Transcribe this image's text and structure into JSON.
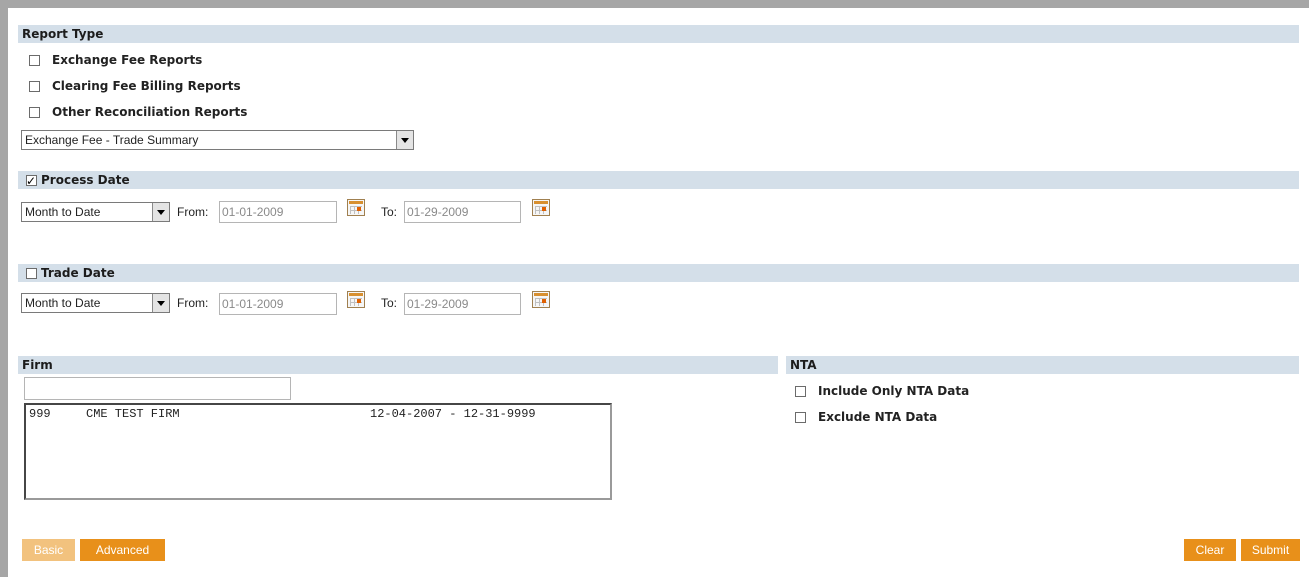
{
  "report_type": {
    "header": "Report Type",
    "options": [
      {
        "label": "Exchange Fee Reports",
        "checked": false
      },
      {
        "label": "Clearing Fee Billing Reports",
        "checked": false
      },
      {
        "label": "Other Reconciliation Reports",
        "checked": false
      }
    ],
    "report_select": "Exchange Fee - Trade Summary"
  },
  "process_date": {
    "header": "Process Date",
    "checked": true,
    "range": "Month to Date",
    "from_label": "From:",
    "from_value": "01-01-2009",
    "to_label": "To:",
    "to_value": "01-29-2009"
  },
  "trade_date": {
    "header": "Trade Date",
    "checked": false,
    "range": "Month to Date",
    "from_label": "From:",
    "from_value": "01-01-2009",
    "to_label": "To:",
    "to_value": "01-29-2009"
  },
  "firm": {
    "header": "Firm",
    "search_value": "",
    "list": [
      {
        "code": "999",
        "name": "CME TEST FIRM",
        "dates": "12-04-2007 - 12-31-9999"
      }
    ]
  },
  "nta": {
    "header": "NTA",
    "options": [
      {
        "label": "Include Only NTA Data",
        "checked": false
      },
      {
        "label": "Exclude NTA Data",
        "checked": false
      }
    ]
  },
  "buttons": {
    "basic": "Basic",
    "advanced": "Advanced",
    "clear": "Clear",
    "submit": "Submit"
  },
  "colors": {
    "section_header_bg": "#d4dfe9",
    "button_active": "#e8901a",
    "button_inactive": "#f2c27e"
  },
  "icons": {
    "calendar": "calendar-icon",
    "dropdown": "chevron-down-icon"
  }
}
